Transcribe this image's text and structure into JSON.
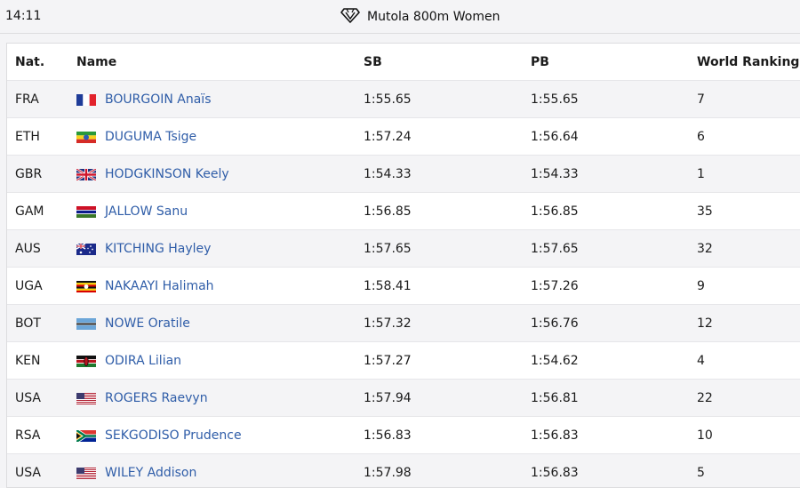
{
  "topbar": {
    "time": "14:11",
    "title": "Mutola 800m Women",
    "logo_icon": "diamond-league-icon"
  },
  "table": {
    "headers": {
      "nat": "Nat.",
      "name": "Name",
      "sb": "SB",
      "pb": "PB",
      "rank": "World Ranking"
    },
    "rows": [
      {
        "nat": "FRA",
        "flag": "flag-france-icon",
        "name": "BOURGOIN Anaïs",
        "sb": "1:55.65",
        "pb": "1:55.65",
        "rank": "7"
      },
      {
        "nat": "ETH",
        "flag": "flag-ethiopia-icon",
        "name": "DUGUMA Tsige",
        "sb": "1:57.24",
        "pb": "1:56.64",
        "rank": "6"
      },
      {
        "nat": "GBR",
        "flag": "flag-uk-icon",
        "name": "HODGKINSON Keely",
        "sb": "1:54.33",
        "pb": "1:54.33",
        "rank": "1"
      },
      {
        "nat": "GAM",
        "flag": "flag-gambia-icon",
        "name": "JALLOW Sanu",
        "sb": "1:56.85",
        "pb": "1:56.85",
        "rank": "35"
      },
      {
        "nat": "AUS",
        "flag": "flag-australia-icon",
        "name": "KITCHING Hayley",
        "sb": "1:57.65",
        "pb": "1:57.65",
        "rank": "32"
      },
      {
        "nat": "UGA",
        "flag": "flag-uganda-icon",
        "name": "NAKAAYI Halimah",
        "sb": "1:58.41",
        "pb": "1:57.26",
        "rank": "9"
      },
      {
        "nat": "BOT",
        "flag": "flag-botswana-icon",
        "name": "NOWE Oratile",
        "sb": "1:57.32",
        "pb": "1:56.76",
        "rank": "12"
      },
      {
        "nat": "KEN",
        "flag": "flag-kenya-icon",
        "name": "ODIRA Lilian",
        "sb": "1:57.27",
        "pb": "1:54.62",
        "rank": "4"
      },
      {
        "nat": "USA",
        "flag": "flag-usa-icon",
        "name": "ROGERS Raevyn",
        "sb": "1:57.94",
        "pb": "1:56.81",
        "rank": "22"
      },
      {
        "nat": "RSA",
        "flag": "flag-south-africa-icon",
        "name": "SEKGODISO Prudence",
        "sb": "1:56.83",
        "pb": "1:56.83",
        "rank": "10"
      },
      {
        "nat": "USA",
        "flag": "flag-usa-icon",
        "name": "WILEY Addison",
        "sb": "1:57.98",
        "pb": "1:56.83",
        "rank": "5"
      }
    ]
  },
  "colors": {
    "link": "#2f5da8",
    "row_alt": "#f4f4f6",
    "border": "#dcdcdf"
  }
}
